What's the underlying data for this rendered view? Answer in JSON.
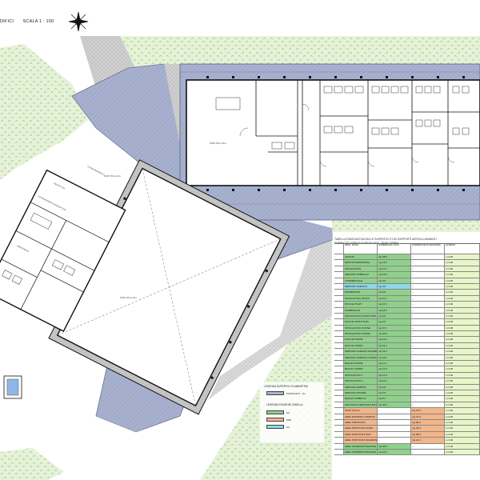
{
  "header": {
    "left_text": "DIFICI",
    "scale_text": "SCALA 1 : 100"
  },
  "compass": {
    "icon": "north-arrow-icon"
  },
  "room_labels": {
    "large_hall": "0.00= 50 m.slm",
    "west_hall": "0.00= 50 m.slm",
    "top_block": "0.00= 50 m.slm",
    "reception": "RECEPTION",
    "foyer": "FOYER/INGRESSO",
    "coordinamento": "COORDINAMENTO/RECEPTION",
    "emergenza": "EMERGENZA"
  },
  "legend": {
    "title_surfaces": "LEGENDA SUPERFICI PLANIMETRIA",
    "porticato": "PORTICATO - Su",
    "title_functions": "LEGENDA FUNZIONI TABELLA",
    "fn_items": [
      "SU",
      "SNR",
      "SA"
    ],
    "colors": {
      "porticato": "#a8b2cf",
      "su": "#8fd18a",
      "snr": "#f3b58a",
      "sa": "#8fd6e6"
    }
  },
  "table": {
    "title": "TABELLA RIASSUNTIVA DELLE SUPERFICI E DEI RAPPORTI AEROILLUMINANTI",
    "subtitle": "FABBRICATO SERVIZI E SPOGLIATOI - PIANO TERRA",
    "headers": [
      "DEST. D'USO",
      "SUPERFICIE UTILE",
      "SUPERFICIE ACCESSORIA",
      "ALTEZZA"
    ],
    "rows": [
      {
        "fn": "su",
        "name": "UFFICIO",
        "su": "mq 38.0",
        "sa": "--",
        "h": "m 3.00"
      },
      {
        "fn": "su",
        "name": "DEPOSITO/DISPENSA",
        "su": "mq 19.5",
        "sa": "--",
        "h": "m 3.00"
      },
      {
        "fn": "su",
        "name": "SPOGLIATOIO",
        "su": "mq 11.5",
        "sa": "--",
        "h": "m 3.00"
      },
      {
        "fn": "su",
        "name": "SERVIZIO PUBBLICO",
        "su": "mq 15.6",
        "sa": "--",
        "h": "m 3.00"
      },
      {
        "fn": "su",
        "name": "COMMERCIALE",
        "su": "mq 9.6",
        "sa": "--",
        "h": "m 3.00"
      },
      {
        "fn": "sa",
        "name": "SERVIZIO IGIENICO",
        "su": "mq 4.5",
        "sa": "--",
        "h": "m 3.00"
      },
      {
        "fn": "su",
        "name": "DISIMPEGNO",
        "su": "mq 6.8",
        "sa": "--",
        "h": "m 3.00"
      },
      {
        "fn": "su",
        "name": "SPOGLIATOIO ATLETI",
        "su": "mq 37.1",
        "sa": "--",
        "h": "m 3.00"
      },
      {
        "fn": "su",
        "name": "DOCCE ATLETI",
        "su": "mq 16.4",
        "sa": "--",
        "h": "m 3.00"
      },
      {
        "fn": "su",
        "name": "DISIMPEGNO",
        "su": "mq 18.3",
        "sa": "--",
        "h": "m 3.00"
      },
      {
        "fn": "su",
        "name": "SPOGLIATOIO ISTRUTTORI",
        "su": "mq 9.6",
        "sa": "--",
        "h": "m 3.00"
      },
      {
        "fn": "su",
        "name": "DOCCE ISTRUTTORI",
        "su": "mq 4.5",
        "sa": "--",
        "h": "m 3.00"
      },
      {
        "fn": "su",
        "name": "SPOGLIATOIO DONNE",
        "su": "mq 37.1",
        "sa": "--",
        "h": "m 3.00"
      },
      {
        "fn": "su",
        "name": "SPOGLIATOIO UOMINI",
        "su": "mq 36.9",
        "sa": "--",
        "h": "m 3.00"
      },
      {
        "fn": "su",
        "name": "DOCCE DONNE",
        "su": "mq 16.4",
        "sa": "--",
        "h": "m 3.00"
      },
      {
        "fn": "su",
        "name": "DOCCE UOMINI",
        "su": "mq 16.4",
        "sa": "--",
        "h": "m 3.00"
      },
      {
        "fn": "su",
        "name": "SERVIZIO IGIENICO DONNE",
        "su": "mq 18.3",
        "sa": "--",
        "h": "m 3.00"
      },
      {
        "fn": "su",
        "name": "SERVIZIO IGIENICO UOMINI",
        "su": "mq 18.3",
        "sa": "--",
        "h": "m 3.00"
      },
      {
        "fn": "su",
        "name": "BAGNO DONNE",
        "su": "mq 11.2",
        "sa": "--",
        "h": "m 3.00"
      },
      {
        "fn": "su",
        "name": "BAGNO UOMINI",
        "su": "mq 11.2",
        "sa": "--",
        "h": "m 3.00"
      },
      {
        "fn": "su",
        "name": "SPOGLIATOIO 1",
        "su": "mq 10.3",
        "sa": "--",
        "h": "m 3.00"
      },
      {
        "fn": "su",
        "name": "SPOGLIATOIO 2",
        "su": "mq 10.3",
        "sa": "--",
        "h": "m 3.00"
      },
      {
        "fn": "su",
        "name": "SERVIZIO ARBITRI",
        "su": "mq 9.8",
        "sa": "--",
        "h": "m 3.00"
      },
      {
        "fn": "su",
        "name": "SERVIZIO DISABILI",
        "su": "mq 5.5",
        "sa": "--",
        "h": "m 3.00"
      },
      {
        "fn": "su",
        "name": "BAGNO PUBBLICO",
        "su": "mq 8.1",
        "sa": "--",
        "h": "m 3.00"
      },
      {
        "fn": "su",
        "name": "OFFICINA E DEPOSITO BICI",
        "su": "mq 36.0",
        "sa": "--",
        "h": "m 3.00"
      },
      {
        "fn": "snr",
        "name": "VANO SCALA",
        "su": "--",
        "sa": "mq 24.5",
        "h": "m 3.00"
      },
      {
        "fn": "snr",
        "name": "AREA ESTERNA COPERTA",
        "su": "--",
        "sa": "mq 37.6",
        "h": "m 3.00"
      },
      {
        "fn": "snr",
        "name": "AREA PORTICATA",
        "su": "--",
        "sa": "mq 98.2",
        "h": "m 3.00"
      },
      {
        "fn": "snr",
        "name": "AREA PORTICATA NORD",
        "su": "--",
        "sa": "mq 46.3",
        "h": "m 3.00"
      },
      {
        "fn": "snr",
        "name": "AREA PORTICATA SUD",
        "su": "--",
        "sa": "mq 58.0",
        "h": "m 3.00"
      },
      {
        "fn": "snr",
        "name": "AREA PORTICATA INGRESSO",
        "su": "--",
        "sa": "mq 21.4",
        "h": "m 3.00"
      },
      {
        "fn": "su",
        "name": "AREA SOMMINISTRAZIONE",
        "su": "mq 46.8",
        "sa": "--",
        "h": "m 3.00"
      },
      {
        "fn": "su",
        "name": "AREA SOMMINISTRAZIONE 2",
        "su": "mq 22.6",
        "sa": "--",
        "h": "m 3.00"
      }
    ]
  }
}
